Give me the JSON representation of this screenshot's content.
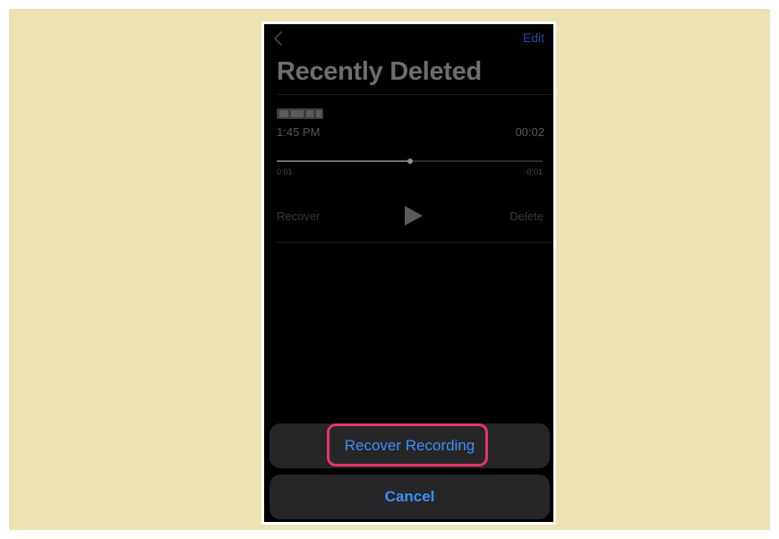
{
  "nav": {
    "back_icon": "chevron-left-icon",
    "edit_label": "Edit",
    "title": "Recently Deleted"
  },
  "recording": {
    "time": "1:45 PM",
    "duration": "00:02",
    "elapsed": "0:01",
    "remaining": "-0:01",
    "progress": 0.5,
    "recover_label": "Recover",
    "play_icon": "play-icon",
    "delete_label": "Delete"
  },
  "action_sheet": {
    "recover_label": "Recover Recording",
    "cancel_label": "Cancel"
  },
  "colors": {
    "backdrop": "#ede2b4",
    "screen": "#000000",
    "accent": "#3e8ff7",
    "highlight": "#e5356a"
  }
}
